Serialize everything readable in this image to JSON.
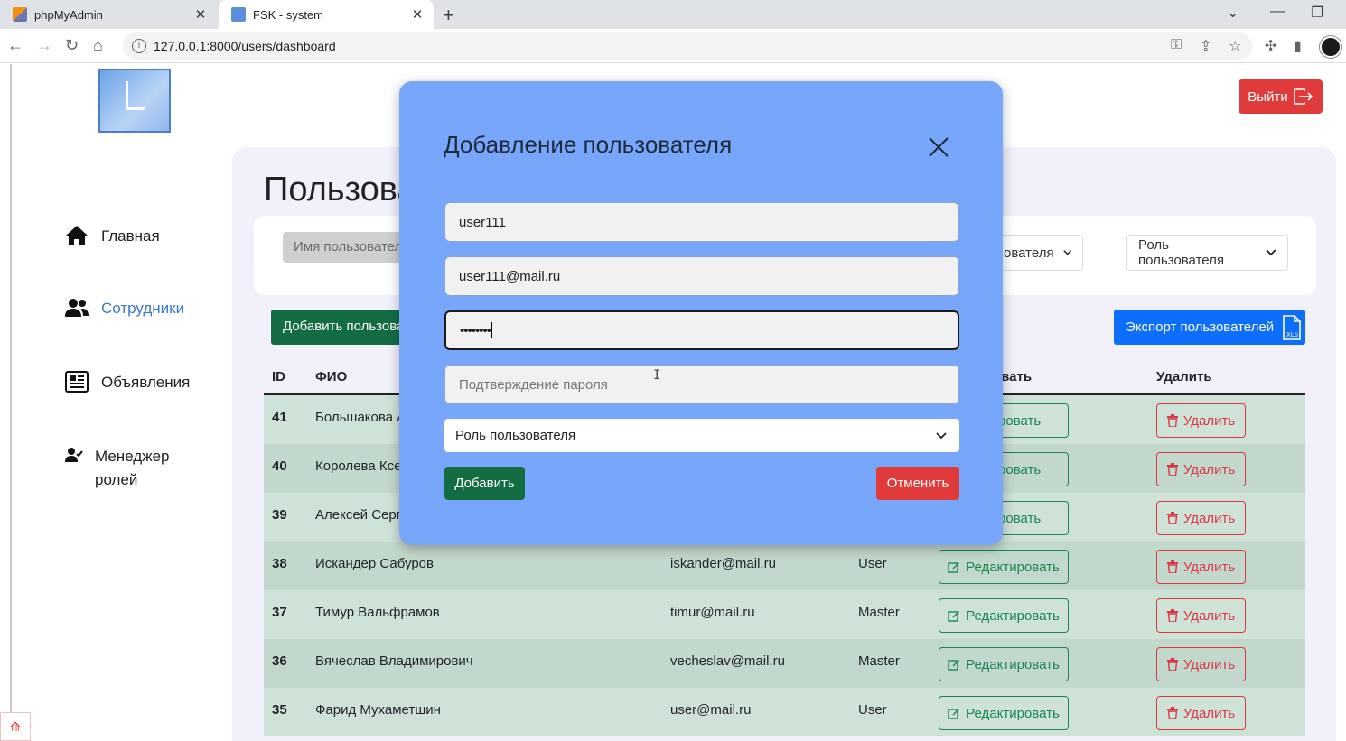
{
  "browser": {
    "tabs": [
      {
        "title": "phpMyAdmin",
        "active": false
      },
      {
        "title": "FSK - system",
        "active": true
      }
    ],
    "url": "127.0.0.1:8000/users/dashboard"
  },
  "header": {
    "logout_label": "Выйти"
  },
  "sidebar": {
    "items": [
      {
        "label": "Главная",
        "icon": "home-icon"
      },
      {
        "label": "Сотрудники",
        "icon": "users-icon",
        "active": true
      },
      {
        "label": "Объявления",
        "icon": "newspaper-icon"
      },
      {
        "label_line1": "Менеджер",
        "label_line2": "ролей",
        "icon": "user-check-icon"
      }
    ]
  },
  "main": {
    "title": "Пользова",
    "filters": {
      "name_placeholder": "Имя пользовател",
      "select_partial": "ователя",
      "role_select": "Роль пользователя"
    },
    "add_user_button": "Добавить пользова",
    "export_button": "Экспорт пользователей",
    "table": {
      "headers": {
        "id": "ID",
        "name": "ФИО",
        "edit": "овать",
        "delete": "Удалить"
      },
      "rows": [
        {
          "id": "41",
          "name": "Большакова А",
          "email": "",
          "role": "",
          "edit": "тировать",
          "delete": "Удалить"
        },
        {
          "id": "40",
          "name": "Королева Ксе",
          "email": "",
          "role": "",
          "edit": "тировать",
          "delete": "Удалить"
        },
        {
          "id": "39",
          "name": "Алексей Серг",
          "email": "",
          "role": "",
          "edit": "тировать",
          "delete": "Удалить"
        },
        {
          "id": "38",
          "name": "Искандер Сабуров",
          "email": "iskander@mail.ru",
          "role": "User",
          "edit": "Редактировать",
          "delete": "Удалить"
        },
        {
          "id": "37",
          "name": "Тимур Вальфрамов",
          "email": "timur@mail.ru",
          "role": "Master",
          "edit": "Редактировать",
          "delete": "Удалить"
        },
        {
          "id": "36",
          "name": "Вячеслав Владимирович",
          "email": "vecheslav@mail.ru",
          "role": "Master",
          "edit": "Редактировать",
          "delete": "Удалить"
        },
        {
          "id": "35",
          "name": "Фарид Мухаметшин",
          "email": "user@mail.ru",
          "role": "User",
          "edit": "Редактировать",
          "delete": "Удалить"
        }
      ]
    }
  },
  "modal": {
    "title": "Добавление пользователя",
    "username_value": "user111",
    "email_value": "user111@mail.ru",
    "password_value": "••••••••",
    "confirm_placeholder": "Подтверждение пароля",
    "role_select": "Роль пользователя",
    "add_button": "Добавить",
    "cancel_button": "Отменить"
  },
  "colors": {
    "modal_bg": "#78a6fb",
    "primary": "#0d6efd",
    "success": "#146c43",
    "danger": "#e03a3a",
    "sidebar_active": "#3a78c9"
  }
}
